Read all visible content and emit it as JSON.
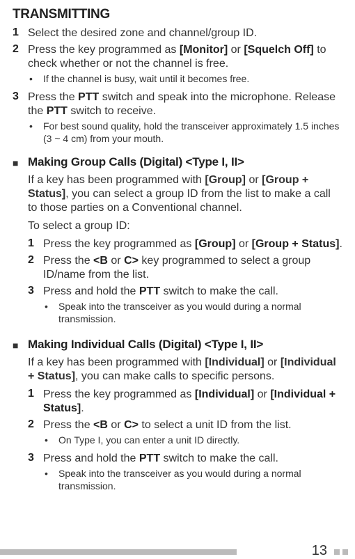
{
  "title": "TRANSMITTING",
  "steps": [
    {
      "num": "1",
      "text": "Select the desired zone and channel/group ID."
    },
    {
      "num": "2",
      "html": "Press the key programmed as <b>[Monitor]</b> or <b>[Squelch Off]</b> to check whether or not the channel is free.",
      "bullets": [
        "If the channel is busy, wait until it becomes free."
      ]
    },
    {
      "num": "3",
      "html": "Press the <b>PTT</b> switch and speak into the microphone. Release the <b>PTT</b> switch to receive.",
      "bullets": [
        "For best sound quality, hold the transceiver approximately 1.5 inches (3 ~ 4 cm) from your mouth."
      ]
    }
  ],
  "section1": {
    "title": "Making Group Calls (Digital) <Type I, II>",
    "intro": "If a key has been programmed with <b>[Group]</b> or <b>[Group + Status]</b>, you can select a group ID from the list to make a call to those parties on a Conventional channel.",
    "lead": "To select a group ID:",
    "steps": [
      {
        "num": "1",
        "html": "Press the key programmed as <b>[Group]</b> or <b>[Group + Status]</b>."
      },
      {
        "num": "2",
        "html": "Press the <b>&lt;B</b> or <b>C&gt;</b> key programmed to select a group ID/name from the list."
      },
      {
        "num": "3",
        "html": "Press and hold the <b>PTT</b> switch to make the call.",
        "bullets": [
          "Speak into the transceiver as you would during a normal transmission."
        ]
      }
    ]
  },
  "section2": {
    "title": "Making Individual Calls (Digital) <Type I, II>",
    "intro": "If a key has been programmed with <b>[Individual]</b> or <b>[Individual + Status]</b>, you can make calls to specific persons.",
    "steps": [
      {
        "num": "1",
        "html": "Press the key programmed as <b>[Individual]</b> or <b>[Individual + Status]</b>."
      },
      {
        "num": "2",
        "html": "Press the <b>&lt;B</b> or <b>C&gt;</b> to select a unit ID from the list.",
        "bullets": [
          "On Type I, you can enter a unit ID directly."
        ]
      },
      {
        "num": "3",
        "html": "Press and hold the <b>PTT</b> switch to make the call.",
        "bullets": [
          "Speak into the transceiver as you would during a normal transmission."
        ]
      }
    ]
  },
  "pageNumber": "13"
}
